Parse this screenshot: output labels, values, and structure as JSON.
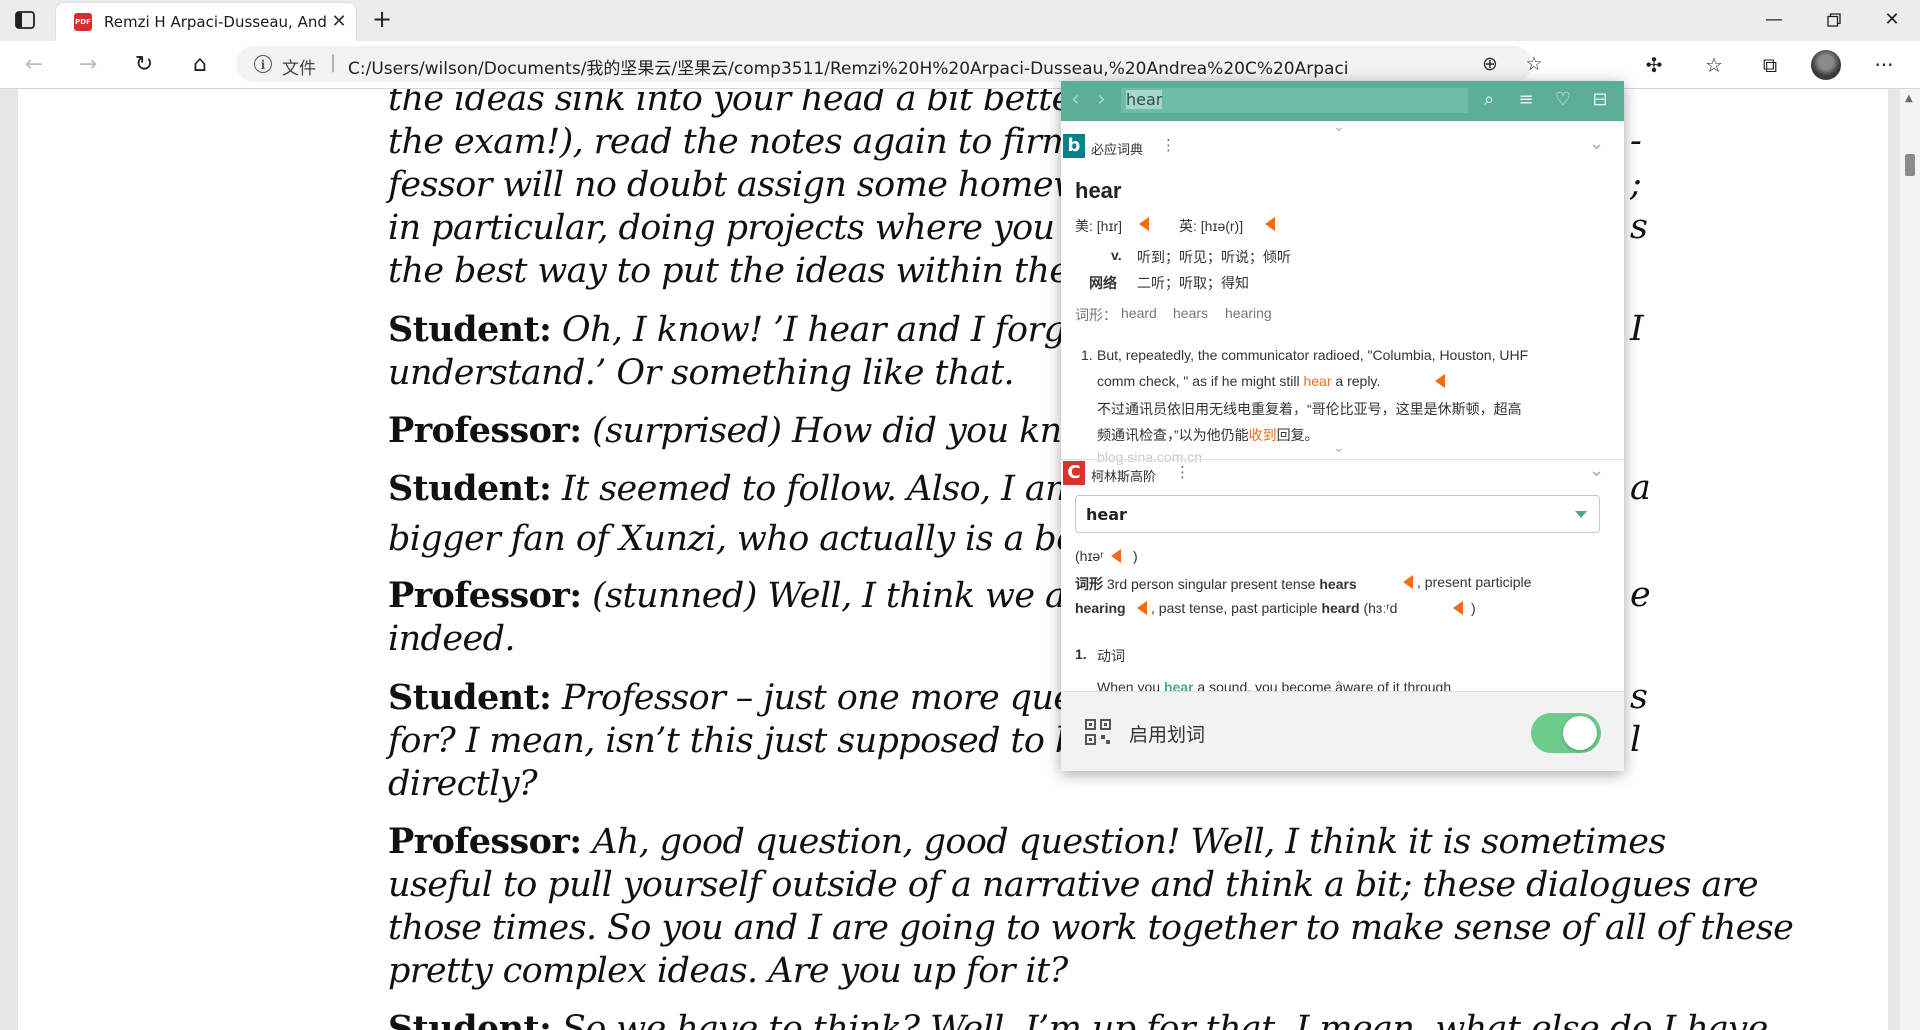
{
  "browser": {
    "tab_title": "Remzi H Arpaci-Dusseau, Andrea",
    "tab_favicon_text": "PDF",
    "address_label": "文件",
    "address_url": "C:/Users/wilson/Documents/我的坚果云/坚果云/comp3511/Remzi%20H%20Arpaci-Dusseau,%20Andrea%20C%20Arpaci-Dusseau%20-%20Op..."
  },
  "document": {
    "lines": [
      {
        "speaker": "",
        "text": "the ideas sink into your head a bit better. Of"
      },
      {
        "speaker": "",
        "text": "the exam!), read the notes again to firm up y"
      },
      {
        "speaker": "",
        "text": "fessor will no doubt assign some homeworks"
      },
      {
        "speaker": "",
        "text": "in particular, doing projects where you wri"
      },
      {
        "speaker": "",
        "text": "the best way to put the ideas within these n"
      },
      {
        "speaker": "Student:",
        "text": " Oh, I know!  ’I hear and I forge"
      },
      {
        "speaker": "",
        "text": "understand.’ Or something like that."
      },
      {
        "speaker": "Professor:",
        "text": " (surprised) How did you know"
      },
      {
        "speaker": "Student:",
        "text": " It seemed to follow.  Also, I am"
      },
      {
        "speaker": "",
        "text": "bigger fan of Xunzi, who actually is a better"
      },
      {
        "speaker": "Professor:",
        "text": " (stunned) Well, I think we are g"
      },
      {
        "speaker": "",
        "text": "indeed."
      },
      {
        "speaker": "Student:",
        "text": " Professor – just one more questio"
      },
      {
        "speaker": "",
        "text": "for? I mean, isn’t this just supposed to be a"
      },
      {
        "speaker": "",
        "text": "directly?"
      },
      {
        "speaker": "Professor:",
        "text": " Ah, good question, good question!  Well, I think it is sometimes"
      },
      {
        "speaker": "",
        "text": "useful to pull yourself outside of a narrative and think a bit; these dialogues are"
      },
      {
        "speaker": "",
        "text": "those times. So you and I are going to work together to make sense of all of these"
      },
      {
        "speaker": "",
        "text": "pretty complex ideas. Are you up for it?"
      },
      {
        "speaker": "Student:",
        "text": " So we have to think? Well, I’m up for that. I mean, what else do I have"
      }
    ],
    "edge_fragments": [
      {
        "text": "-"
      },
      {
        "text": ";"
      },
      {
        "text": "s"
      },
      {
        "text": "I"
      },
      {
        "text": "a"
      },
      {
        "text": "e"
      },
      {
        "text": "s"
      },
      {
        "text": "l"
      }
    ]
  },
  "dictionary": {
    "search_value": "hear",
    "bing": {
      "logo": "b",
      "title": "必应词典",
      "headword": "hear",
      "us_label": "美: [hɪr]",
      "uk_label": "英: [hɪə(r)]",
      "pos": "v.",
      "pos_meaning": "听到；听见；听说；倾听",
      "web_label": "网络",
      "web_meaning": "二听；听取；得知",
      "forms_label": "词形：",
      "forms": [
        "heard",
        "hears",
        "hearing"
      ],
      "example_num": "1.",
      "example_en_1": "But, repeatedly, the communicator radioed, \"Columbia, Houston, UHF",
      "example_en_2a": "comm check, \" as if he might still ",
      "example_en_2b": "hear",
      "example_en_2c": " a reply.",
      "example_zh_1": "不过通讯员依旧用无线电重复着，“哥伦比亚号，这里是休斯顿，超高",
      "example_zh_2a": "频通讯检查，”以为他仍能",
      "example_zh_2b": "收到",
      "example_zh_2c": "回复。",
      "source": "blog.sina.com.cn"
    },
    "collins": {
      "logo": "C",
      "title": "柯林斯高阶",
      "select_value": "hear",
      "pron": "(hɪəʳ",
      "pron_close": ")",
      "forms_label": "词形",
      "forms_text_1": " 3rd person singular present tense ",
      "form_hears": "hears",
      "forms_text_2": " , present participle",
      "form_hearing": "hearing",
      "forms_text_3": " , past tense, past participle ",
      "form_heard": "heard",
      "heard_pron": " (hɜːʳd",
      "heard_close": ")",
      "sense_num": "1.",
      "sense_pos": "动词",
      "sense_preview_a": "When you ",
      "sense_preview_b": "hear",
      "sense_preview_c": " a sound, you become aware of it through"
    },
    "footer_label": "启用划词",
    "toggle_on": true
  },
  "colors": {
    "dict_header": "#5cae98",
    "accent_orange": "#f26b1d",
    "toggle_on": "#6dcb8c",
    "bing_logo": "#0b7f8a",
    "collins_logo": "#d9342b"
  }
}
